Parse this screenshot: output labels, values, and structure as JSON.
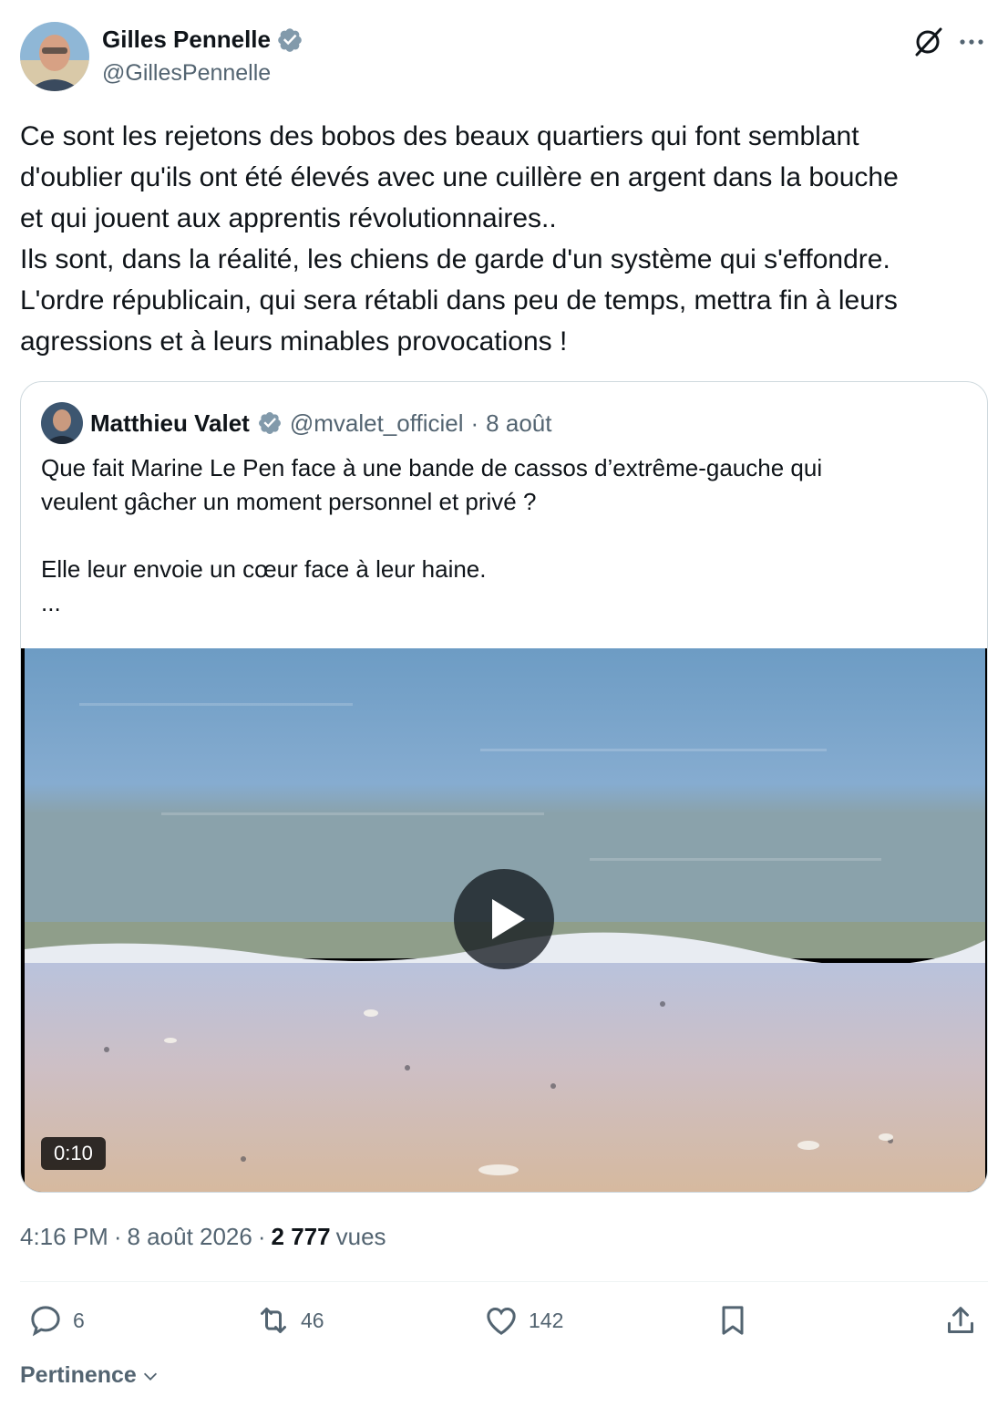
{
  "author": {
    "name": "Gilles Pennelle",
    "handle": "@GillesPennelle"
  },
  "tweet_lines": [
    "Ce sont les rejetons des bobos des beaux quartiers qui font semblant",
    "d'oublier qu'ils ont été élevés avec une cuillère en argent dans la bouche",
    "et qui jouent aux apprentis révolutionnaires..",
    "Ils sont, dans la réalité, les chiens de garde d'un système qui s'effondre.",
    "L'ordre républicain, qui sera rétabli dans peu de temps, mettra fin à leurs",
    "agressions et à leurs minables provocations !"
  ],
  "quote": {
    "name": "Matthieu Valet",
    "handle": "@mvalet_officiel",
    "separator": "·",
    "date": "8 août",
    "line1": "Que fait Marine Le Pen face à une bande de cassos d’extrême-gauche qui",
    "line2": "veulent gâcher un moment personnel et privé ?",
    "line3": "Elle leur envoie un cœur face à leur haine.",
    "line4": "...",
    "video_duration": "0:10"
  },
  "meta": {
    "time": "4:16 PM",
    "sep1": "·",
    "date": "8 août 2026",
    "sep2": "·",
    "views": "2 777",
    "views_label": "vues"
  },
  "actions": {
    "replies": "6",
    "reposts": "46",
    "likes": "142"
  },
  "sort_label": "Pertinence",
  "colors": {
    "text": "#0f1419",
    "secondary": "#536471",
    "border": "#cfd9de",
    "verified": "#829aab"
  }
}
